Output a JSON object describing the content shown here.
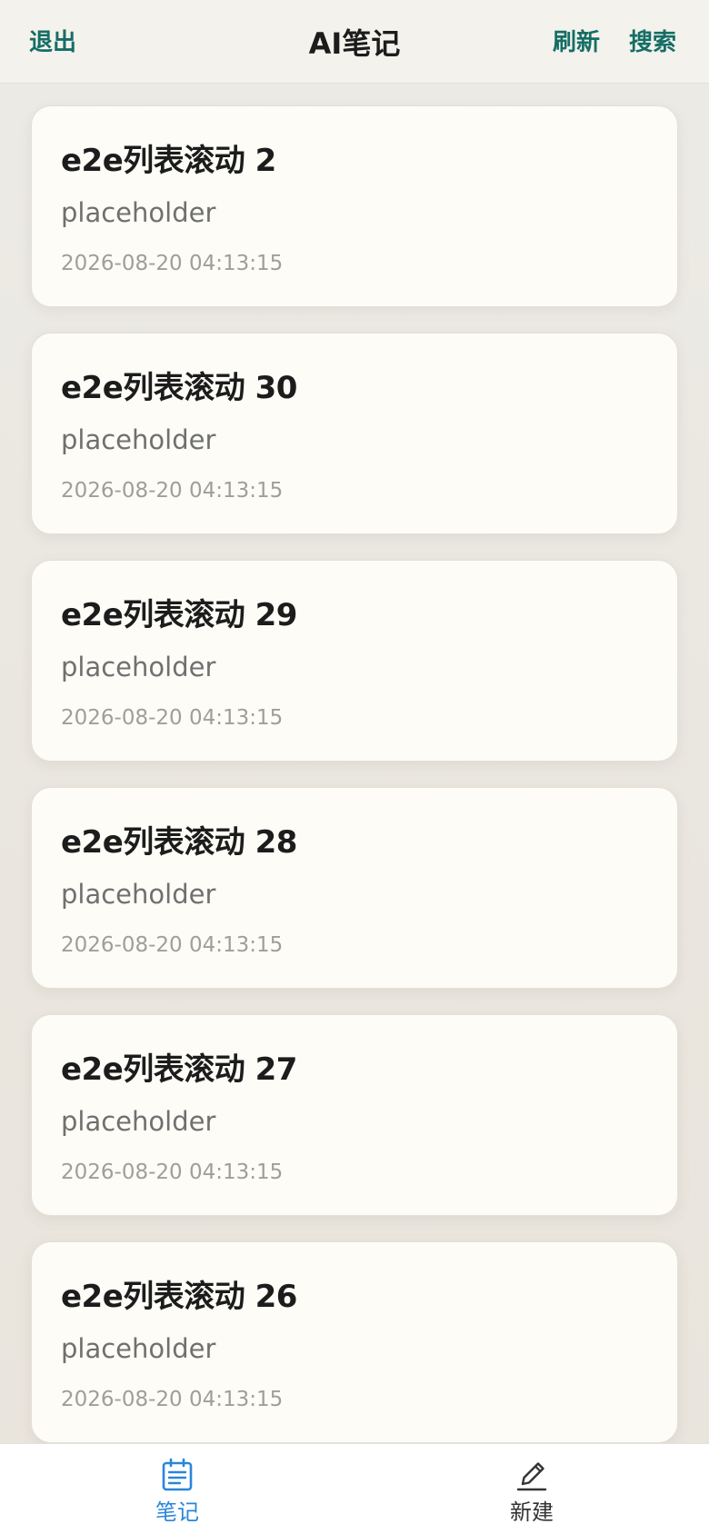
{
  "header": {
    "logout_label": "退出",
    "title": "AI笔记",
    "refresh_label": "刷新",
    "search_label": "搜索"
  },
  "notes": [
    {
      "title": "e2e列表滚动 2",
      "body": "placeholder",
      "time": "2026-08-20 04:13:15"
    },
    {
      "title": "e2e列表滚动 30",
      "body": "placeholder",
      "time": "2026-08-20 04:13:15"
    },
    {
      "title": "e2e列表滚动 29",
      "body": "placeholder",
      "time": "2026-08-20 04:13:15"
    },
    {
      "title": "e2e列表滚动 28",
      "body": "placeholder",
      "time": "2026-08-20 04:13:15"
    },
    {
      "title": "e2e列表滚动 27",
      "body": "placeholder",
      "time": "2026-08-20 04:13:15"
    },
    {
      "title": "e2e列表滚动 26",
      "body": "placeholder",
      "time": "2026-08-20 04:13:15"
    }
  ],
  "tabbar": {
    "notes": {
      "label": "笔记",
      "icon": "notes-icon",
      "active": true
    },
    "new": {
      "label": "新建",
      "icon": "edit-icon",
      "active": false
    }
  },
  "colors": {
    "accent": "#156e66",
    "tab_active": "#2a86d9",
    "card_bg": "#fdfcf7"
  }
}
